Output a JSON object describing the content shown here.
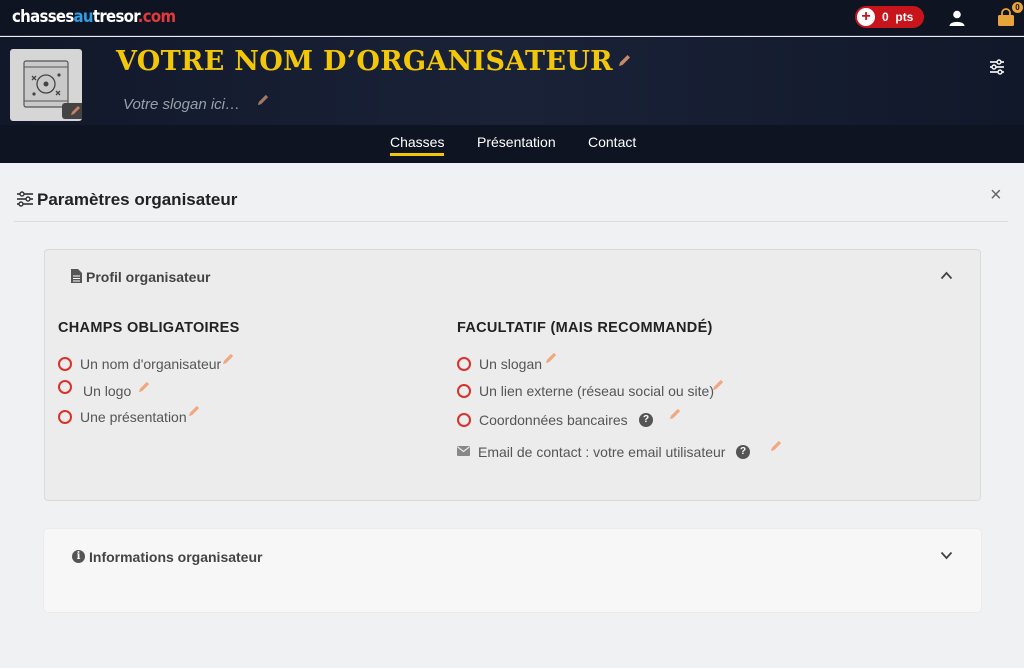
{
  "topbar": {
    "logo": {
      "part1": "chasses",
      "part2": "au",
      "part3": "tresor",
      "part4": ".com"
    },
    "points": {
      "plus": "+",
      "value": "0",
      "unit": "pts"
    },
    "cart_count": "0"
  },
  "header": {
    "organizer_name": "VOTRE NOM D’ORGANISATEUR",
    "slogan": "Votre slogan ici…",
    "title_color": "#f2c70a"
  },
  "tabs": [
    {
      "label": "Chasses",
      "active": true
    },
    {
      "label": "Présentation",
      "active": false
    },
    {
      "label": "Contact",
      "active": false
    }
  ],
  "panel": {
    "title": "Paramètres organisateur",
    "close": "×"
  },
  "profile_card": {
    "title": "Profil organisateur",
    "required": {
      "title": "CHAMPS OBLIGATOIRES",
      "items": [
        "Un nom d'organisateur",
        "Un logo",
        "Une présentation"
      ]
    },
    "optional": {
      "title": "FACULTATIF (MAIS RECOMMANDÉ)",
      "items": [
        "Un slogan",
        "Un lien externe (réseau social ou site)",
        "Coordonnées bancaires",
        "Email de contact : votre email utilisateur"
      ]
    },
    "help": "?"
  },
  "info_card": {
    "title": "Informations organisateur",
    "icon": "i"
  },
  "colors": {
    "accent": "#f2c70a",
    "status_missing": "#d9322a",
    "pencil": "#e8a070",
    "points_bg": "#c8141b"
  }
}
